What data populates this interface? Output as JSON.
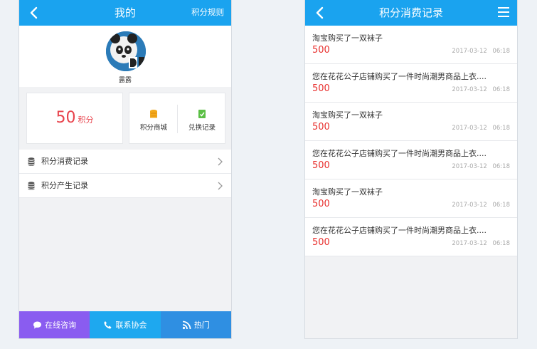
{
  "colors": {
    "header": "#1aa3ef",
    "points_red": "#e8424b",
    "tab_consult": "#8a5cf0",
    "tab_contact": "#1ea8ef",
    "tab_hot": "#2f8fe2"
  },
  "mine": {
    "header": {
      "title": "我的",
      "right_link": "积分规则",
      "back_icon": "chevron-left-icon"
    },
    "profile": {
      "username": "露露",
      "avatar_icon": "panda-avatar"
    },
    "points": {
      "value": "50",
      "unit": "积分"
    },
    "actions": [
      {
        "label": "积分商城",
        "icon": "coin-stack-icon"
      },
      {
        "label": "兑换记录",
        "icon": "clipboard-check-icon"
      }
    ],
    "menu": [
      {
        "label": "积分消费记录",
        "icon": "database-icon"
      },
      {
        "label": "积分产生记录",
        "icon": "database-icon"
      }
    ],
    "tabs": [
      {
        "label": "在线咨询",
        "icon": "chat-bubble-icon"
      },
      {
        "label": "联系协会",
        "icon": "phone-icon"
      },
      {
        "label": "热门",
        "icon": "rss-icon"
      }
    ]
  },
  "records_page": {
    "header": {
      "title": "积分消费记录",
      "back_icon": "chevron-left-icon",
      "menu_icon": "hamburger-menu-icon"
    },
    "records": [
      {
        "title": "淘宝购买了一双袜子",
        "points": "500",
        "time": "2017-03-12 06:18"
      },
      {
        "title": "您在花花公子店铺购买了一件时尚潮男商品上衣....",
        "points": "500",
        "time": "2017-03-12 06:18"
      },
      {
        "title": "淘宝购买了一双袜子",
        "points": "500",
        "time": "2017-03-12 06:18"
      },
      {
        "title": "您在花花公子店铺购买了一件时尚潮男商品上衣....",
        "points": "500",
        "time": "2017-03-12 06:18"
      },
      {
        "title": "淘宝购买了一双袜子",
        "points": "500",
        "time": "2017-03-12 06:18"
      },
      {
        "title": "您在花花公子店铺购买了一件时尚潮男商品上衣....",
        "points": "500",
        "time": "2017-03-12 06:18"
      }
    ]
  }
}
